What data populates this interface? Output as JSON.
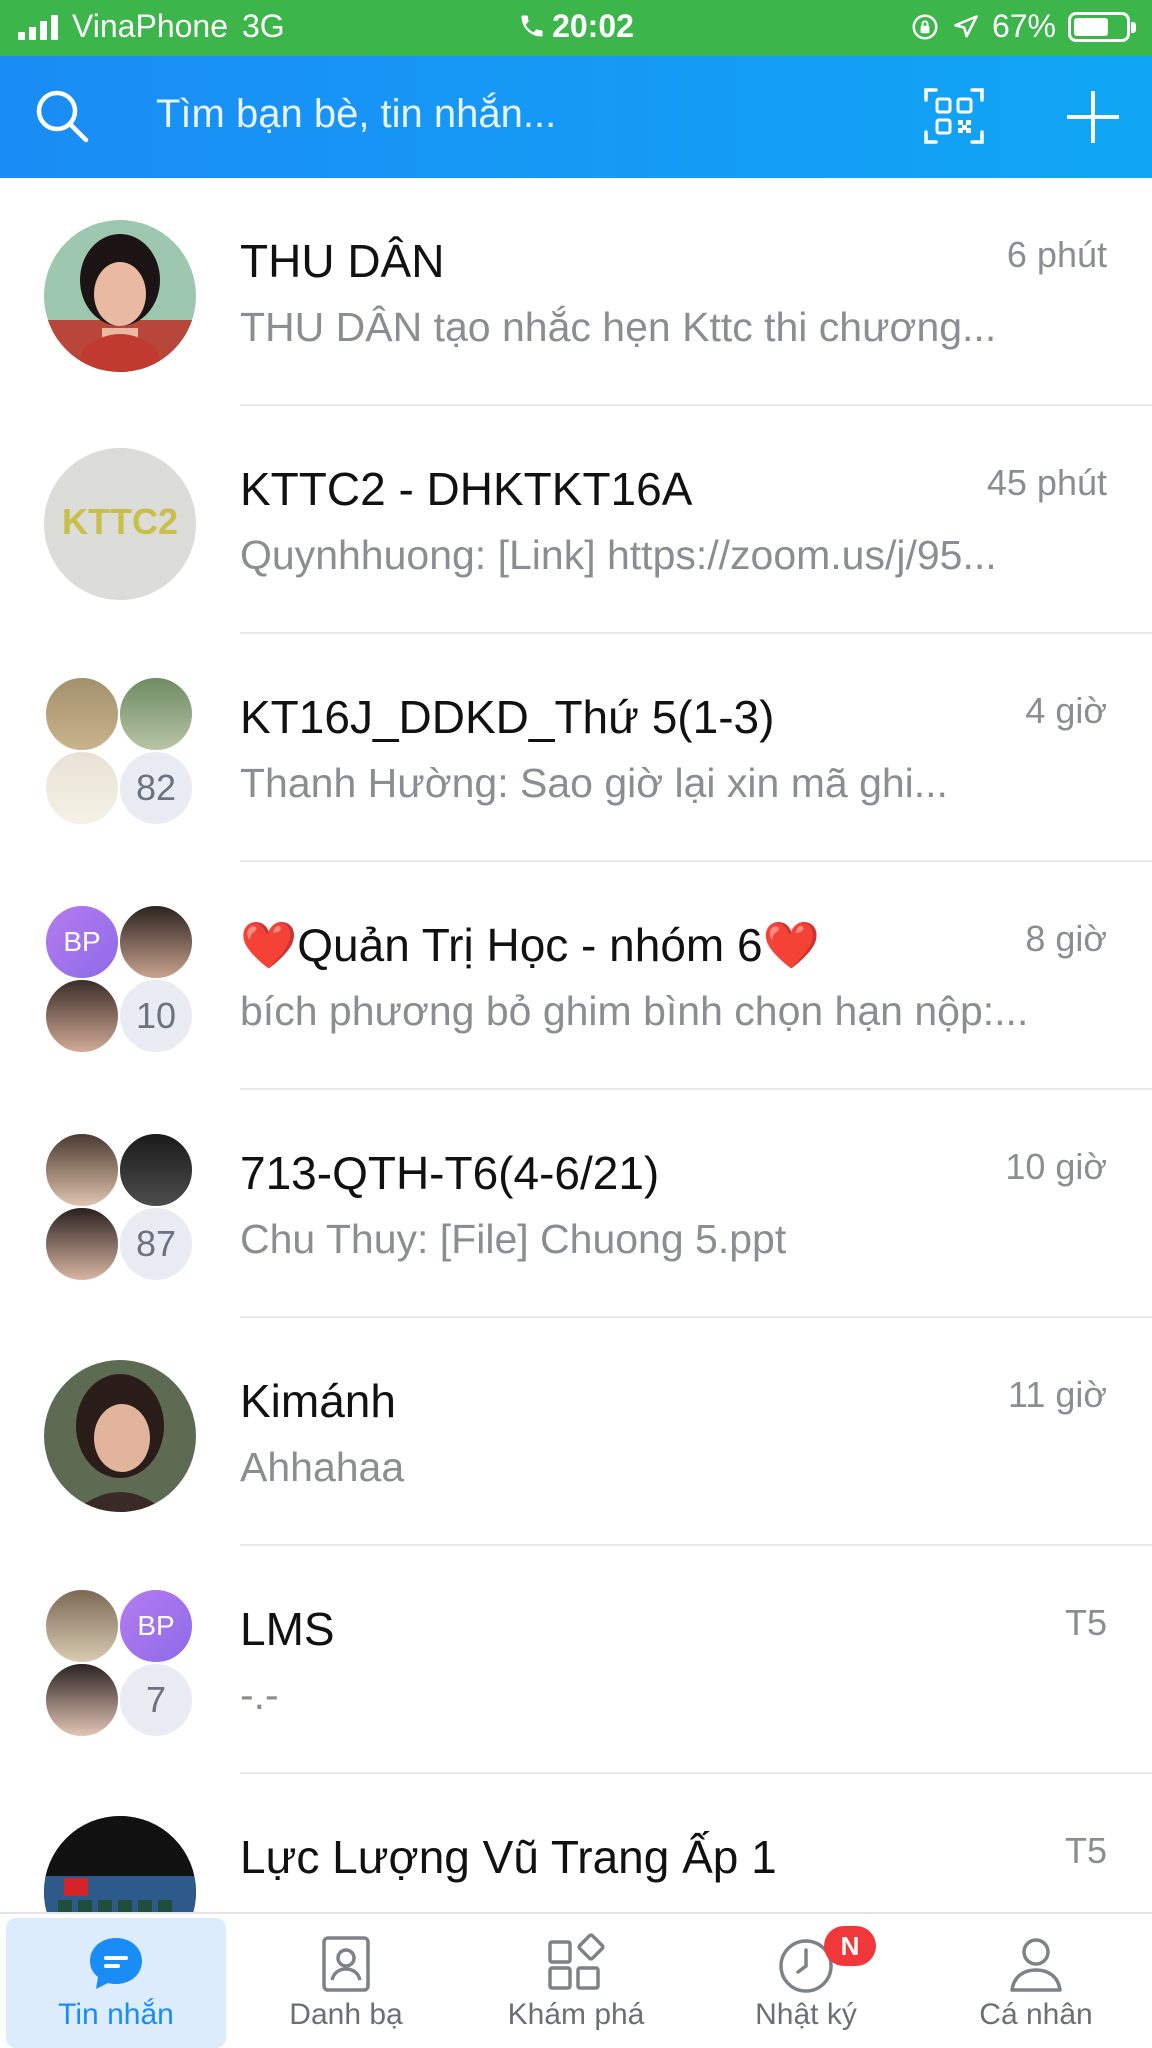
{
  "status_bar": {
    "carrier": "VinaPhone",
    "network": "3G",
    "time": "20:02",
    "battery": "67%",
    "battery_level": 0.67,
    "icons": [
      "signal-icon",
      "phone-icon",
      "rotation-lock-icon",
      "location-arrow-icon",
      "battery-icon"
    ]
  },
  "header": {
    "search_placeholder": "Tìm bạn bè, tin nhắn...",
    "icons": [
      "search-icon",
      "qr-code-icon",
      "plus-icon"
    ],
    "background": "#1a8cf5"
  },
  "chats": [
    {
      "name": "THU DÂN",
      "time": "6 phút",
      "preview": "THU DÂN tạo nhắc hẹn Kttc thi chương..."
    },
    {
      "name": "KTTC2 - DHKTKT16A",
      "time": "45 phút",
      "preview": "Quynhhuong: [Link] https://zoom.us/j/95...",
      "avatar_text": "KTTC2"
    },
    {
      "name": "KT16J_DDKD_Thứ 5(1-3)",
      "time": "4 giờ",
      "preview": "Thanh Hường: Sao giờ lại xin mã ghi...",
      "member_count": "82"
    },
    {
      "name_prefix": "❤️",
      "name": "Quản Trị Học - nhóm 6",
      "name_suffix": "❤️",
      "time": "8 giờ",
      "preview": "bích phương bỏ ghim bình chọn hạn nộp:...",
      "member_count": "10",
      "initials": "BP"
    },
    {
      "name": "713-QTH-T6(4-6/21)",
      "time": "10 giờ",
      "preview": "Chu Thuy: [File] Chuong 5.ppt",
      "member_count": "87"
    },
    {
      "name": "Kimánh",
      "time": "11 giờ",
      "preview": "Ahhahaa"
    },
    {
      "name": "LMS",
      "time": "T5",
      "preview": "-.-",
      "member_count": "7",
      "initials": "BP"
    },
    {
      "name": "Lực Lượng Vũ Trang Ấp 1",
      "time": "T5",
      "preview": ""
    }
  ],
  "bottom_nav": [
    {
      "label": "Tin nhắn",
      "icon": "chat-bubble-icon",
      "active": true
    },
    {
      "label": "Danh bạ",
      "icon": "contacts-icon",
      "active": false
    },
    {
      "label": "Khám phá",
      "icon": "discover-grid-icon",
      "active": false
    },
    {
      "label": "Nhật ký",
      "icon": "clock-icon",
      "active": false,
      "badge": "N"
    },
    {
      "label": "Cá nhân",
      "icon": "profile-icon",
      "active": false
    }
  ],
  "colors": {
    "status_green": "#3cb64a",
    "accent_blue": "#1a8cf5",
    "badge_red": "#f0383b"
  }
}
